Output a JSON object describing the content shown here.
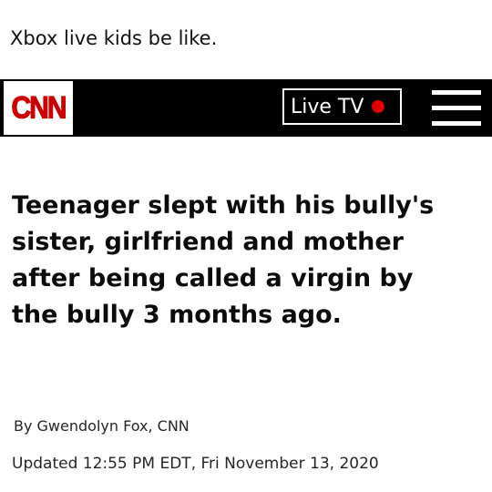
{
  "caption": "Xbox live kids be like.",
  "header": {
    "logo": "CNN",
    "live_tv_label": "Live TV",
    "menu_icon": "hamburger-menu-icon",
    "live_dot_color": "#e00000"
  },
  "article": {
    "headline": "Teenager slept with his bully's sister, girlfriend and mother after being called a virgin by the bully 3 months ago.",
    "byline": "By Gwendolyn Fox, CNN",
    "updated": "Updated 12:55 PM EDT, Fri November 13, 2020"
  },
  "colors": {
    "brand_red": "#cc0000",
    "navbar": "#000000"
  }
}
